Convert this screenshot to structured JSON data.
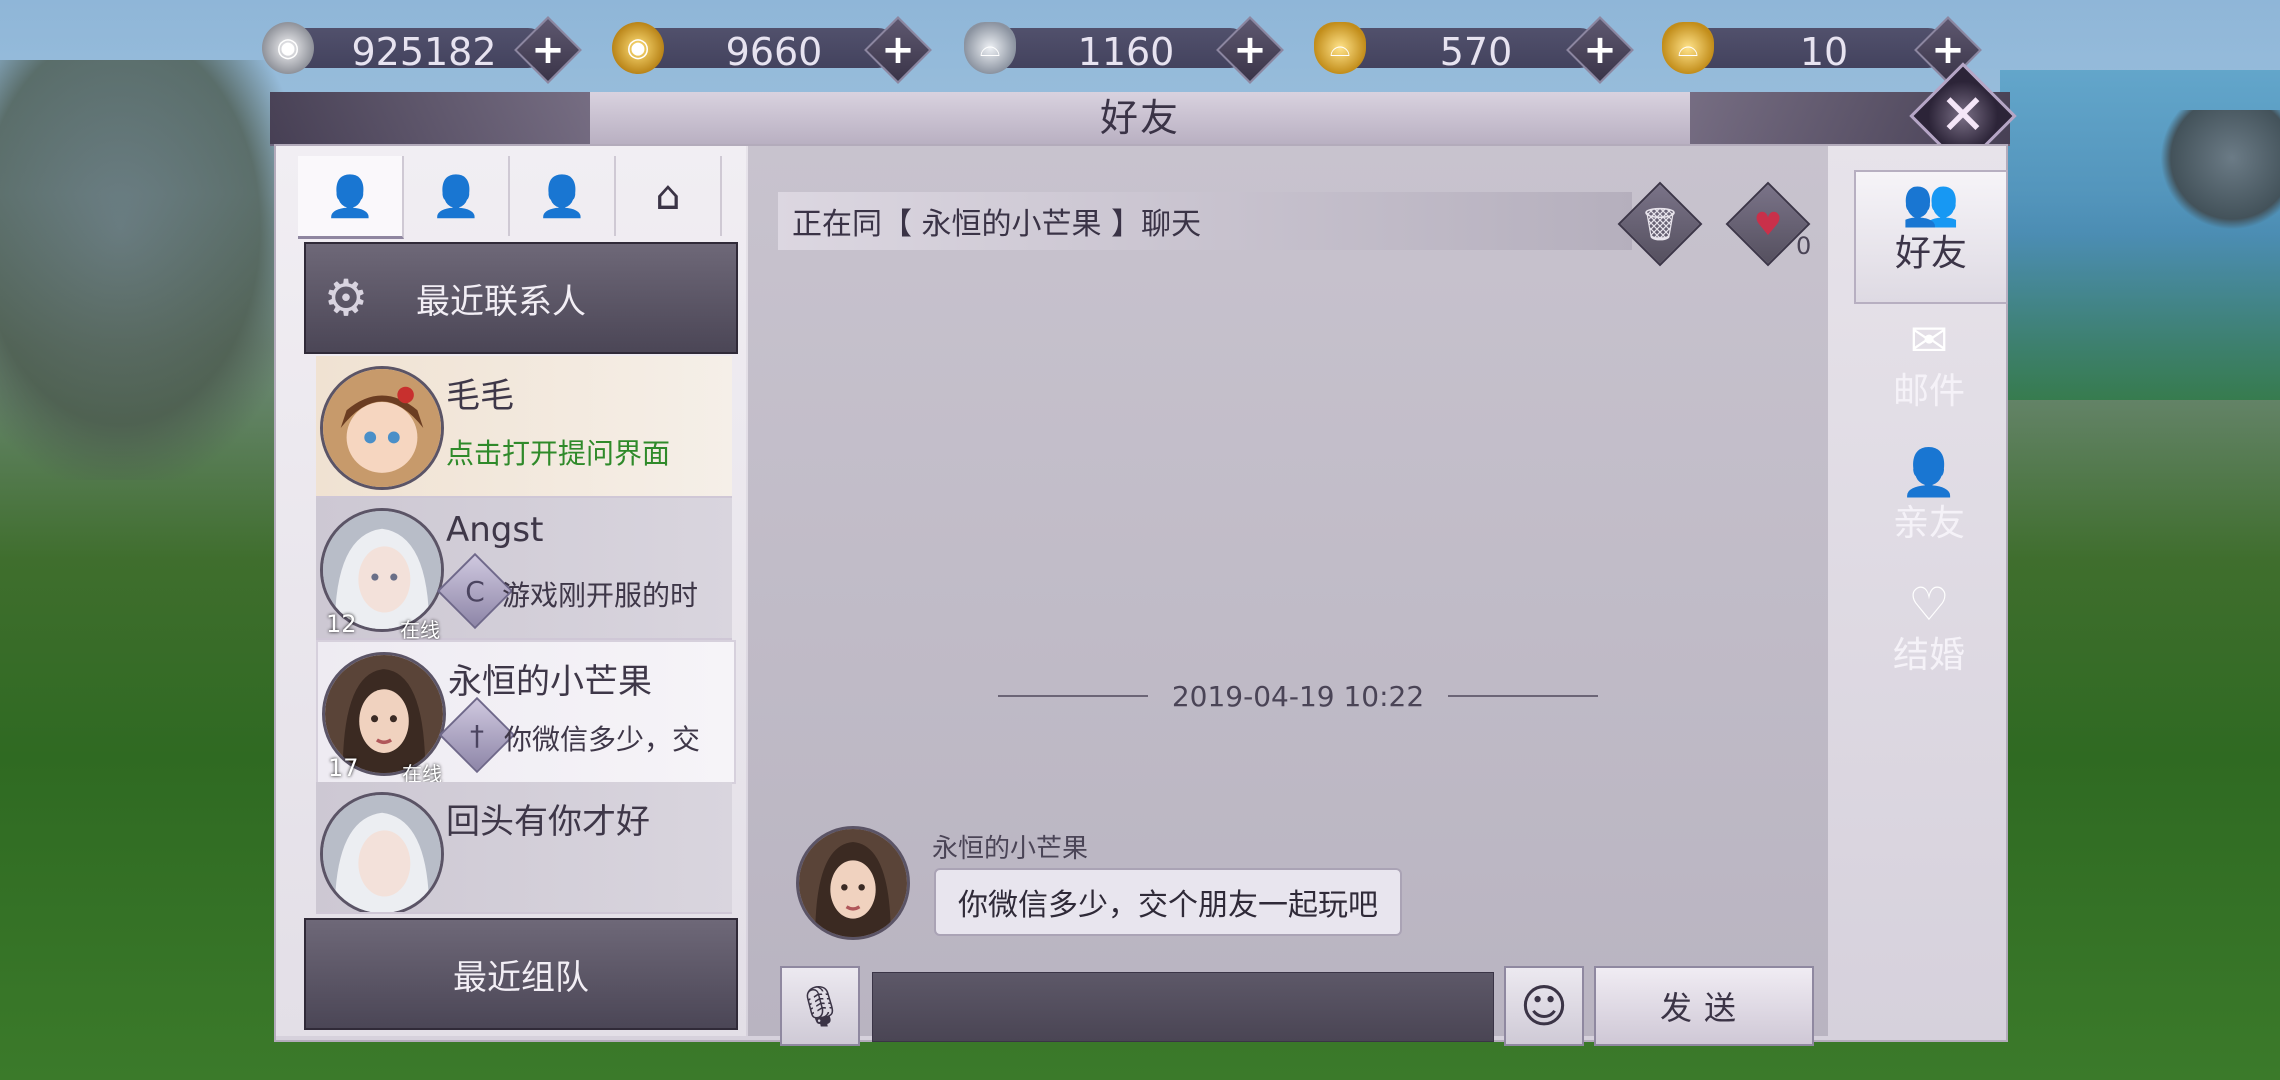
{
  "currencies": [
    {
      "name": "silver-coin",
      "value": "925182",
      "icon": "silver-coin-icon"
    },
    {
      "name": "gold-coin",
      "value": "9660",
      "icon": "gold-coin-icon"
    },
    {
      "name": "silver-ingot",
      "value": "1160",
      "icon": "silver-ingot-icon"
    },
    {
      "name": "locked-gold-ingot",
      "value": "570",
      "icon": "locked-gold-ingot-icon"
    },
    {
      "name": "gold-ingot",
      "value": "10",
      "icon": "gold-ingot-icon"
    }
  ],
  "window": {
    "title": "好友"
  },
  "left": {
    "section_title": "最近联系人",
    "contacts": [
      {
        "name": "毛毛",
        "message": "点击打开提问界面"
      },
      {
        "name": "Angst",
        "message": "游戏刚开服的时",
        "level": "12",
        "status": "在线"
      },
      {
        "name": "永恒的小芒果",
        "message": "你微信多少，交",
        "level": "17",
        "status": "在线"
      },
      {
        "name": "回头有你才好",
        "message": ""
      }
    ],
    "recent_team": "最近组队"
  },
  "chat": {
    "header": "正在同【 永恒的小芒果 】聊天",
    "heart_count": "0",
    "date": "2019-04-19 10:22",
    "sender": "永恒的小芒果",
    "message": "你微信多少，交个朋友一起玩吧",
    "send_label": "发送"
  },
  "side_tabs": [
    {
      "label": "好友",
      "icon": "friends-icon"
    },
    {
      "label": "邮件",
      "icon": "mail-icon"
    },
    {
      "label": "亲友",
      "icon": "family-icon"
    },
    {
      "label": "结婚",
      "icon": "marriage-icon"
    }
  ]
}
